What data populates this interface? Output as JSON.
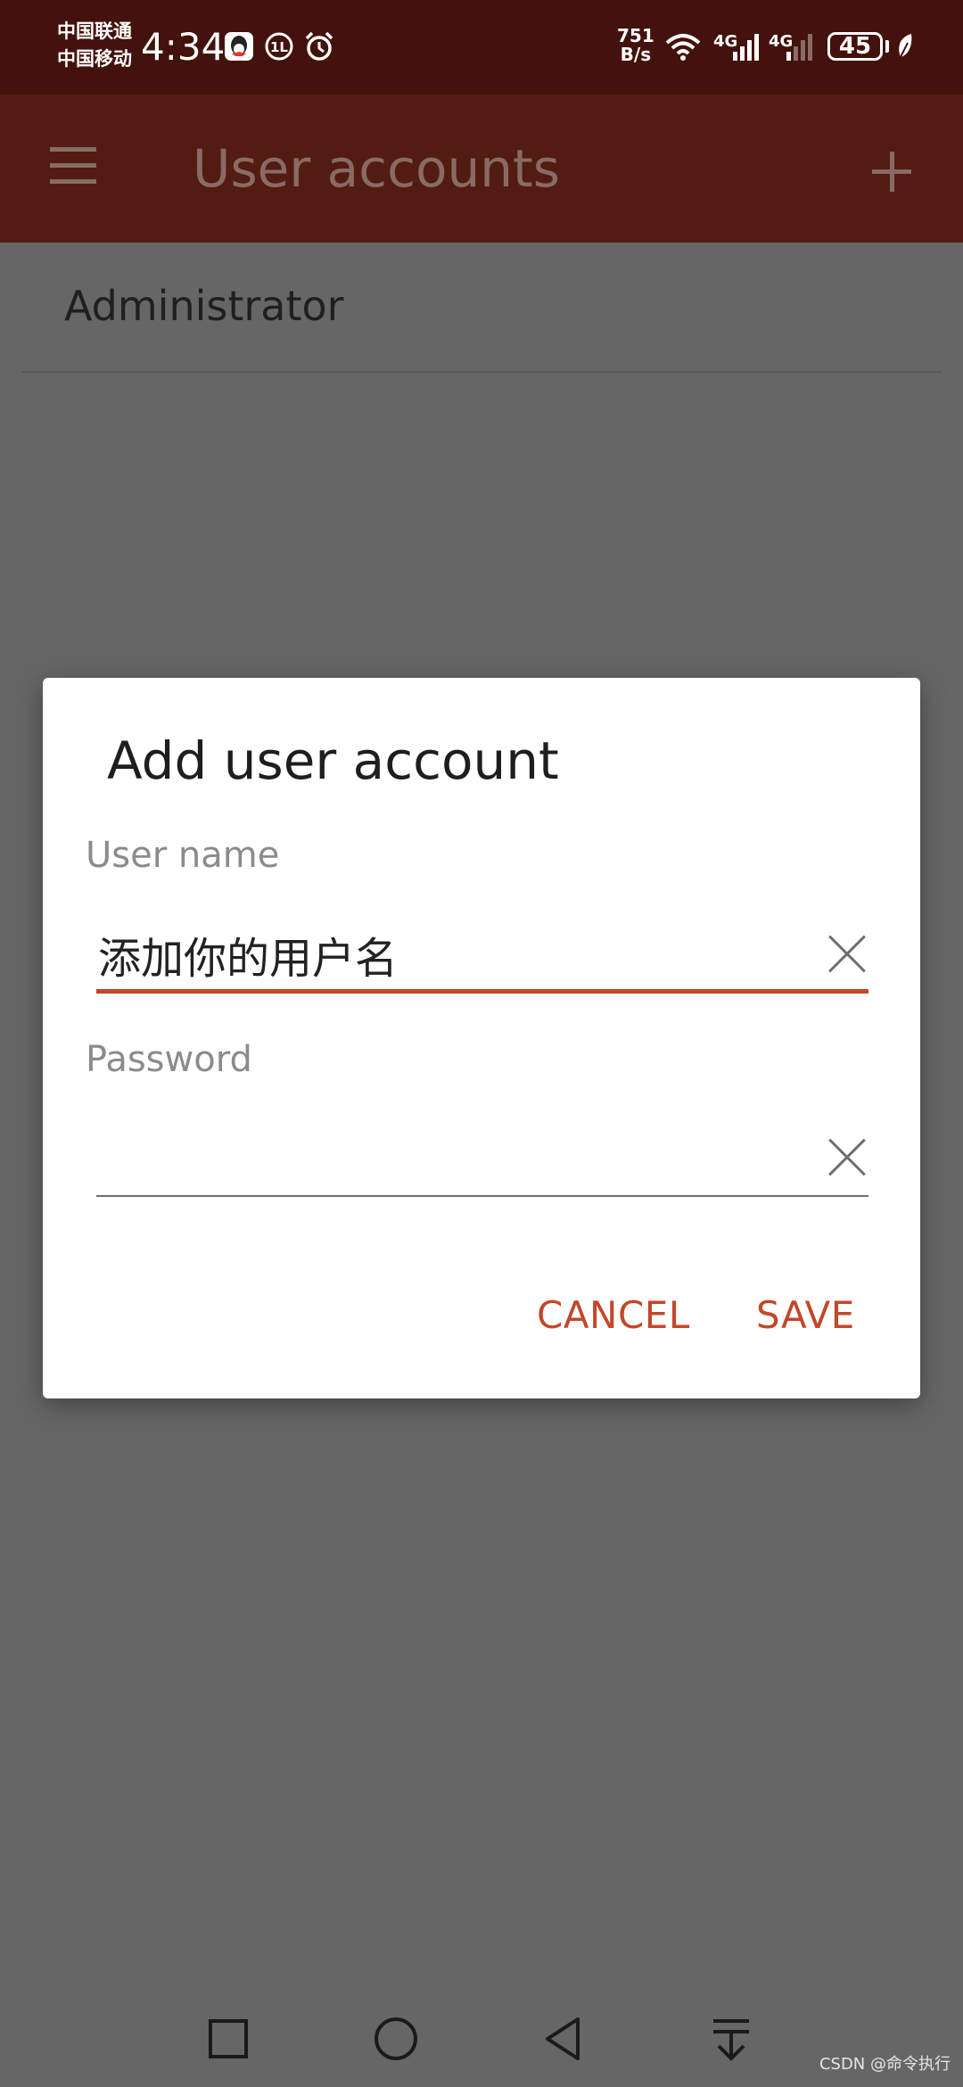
{
  "status_bar": {
    "carrier1": "中国联通",
    "carrier2": "中国移动",
    "time": "4:34",
    "net_speed_value": "751",
    "net_speed_unit": "B/s",
    "network1": "4G",
    "network2": "4G",
    "battery": "45"
  },
  "app_bar": {
    "title": "User accounts"
  },
  "accounts": [
    {
      "name": "Administrator"
    }
  ],
  "dialog": {
    "title": "Add user account",
    "username_label": "User name",
    "username_value": "添加你的用户名",
    "password_label": "Password",
    "password_value": "",
    "cancel_label": "CANCEL",
    "save_label": "SAVE"
  },
  "colors": {
    "accent": "#c2472b",
    "status_bar_bg": "#43120c",
    "app_bar_bg": "#521c12"
  },
  "watermark": "CSDN @命令执行"
}
